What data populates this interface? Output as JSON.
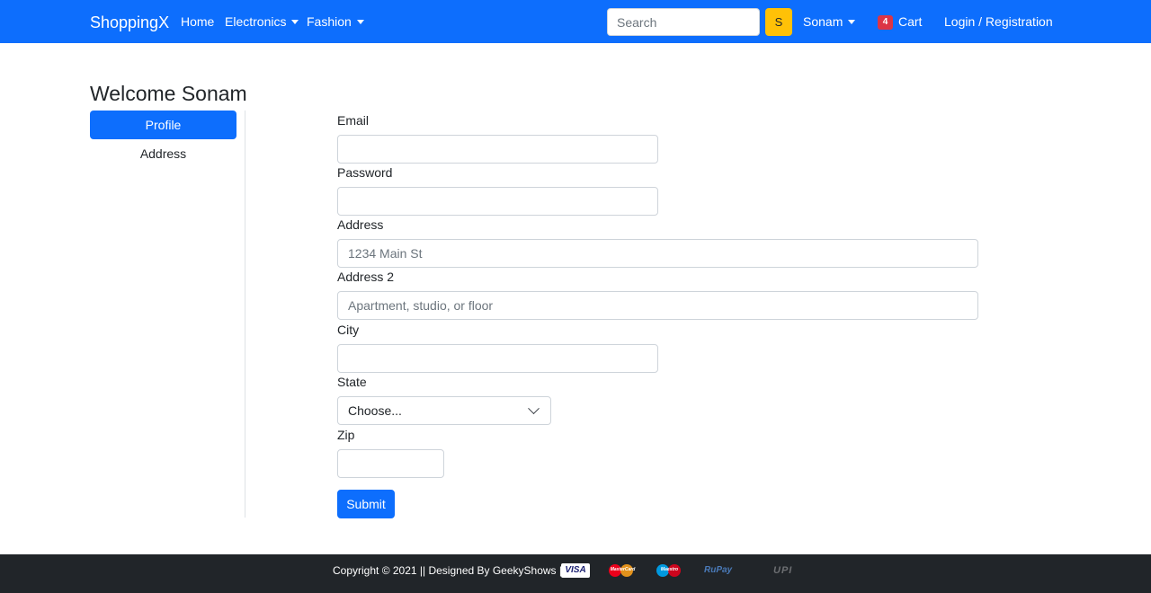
{
  "navbar": {
    "brand": "ShoppingX",
    "links": [
      {
        "label": "Home"
      },
      {
        "label": "Electronics"
      },
      {
        "label": "Fashion"
      }
    ],
    "search_placeholder": "Search",
    "search_button": "S",
    "user_menu": "Sonam",
    "cart_count": "4",
    "cart_label": "Cart",
    "login_label": "Login / Registration",
    "color": "#0d6efd"
  },
  "sidebar": {
    "welcome": "Welcome Sonam",
    "items": [
      {
        "label": "Profile",
        "active": true
      },
      {
        "label": "Address",
        "active": false
      }
    ]
  },
  "form": {
    "email_label": "Email",
    "email_value": "",
    "password_label": "Password",
    "password_value": "",
    "address_label": "Address",
    "address_placeholder": "1234 Main St",
    "address2_label": "Address 2",
    "address2_placeholder": "Apartment, studio, or floor",
    "city_label": "City",
    "city_value": "",
    "state_label": "State",
    "state_selected": "Choose...",
    "zip_label": "Zip",
    "zip_value": "",
    "submit_label": "Submit"
  },
  "footer": {
    "copyright": "Copyright © 2021 || Designed By GeekyShows ||",
    "payment_logos": [
      {
        "name": "visa-logo",
        "text": "VISA"
      },
      {
        "name": "mastercard-logo",
        "text": "MasterCard"
      },
      {
        "name": "maestro-logo",
        "text": "Maestro"
      },
      {
        "name": "rupay-logo",
        "text": "RuPay"
      },
      {
        "name": "upi-logo",
        "text": "UPI"
      }
    ]
  }
}
